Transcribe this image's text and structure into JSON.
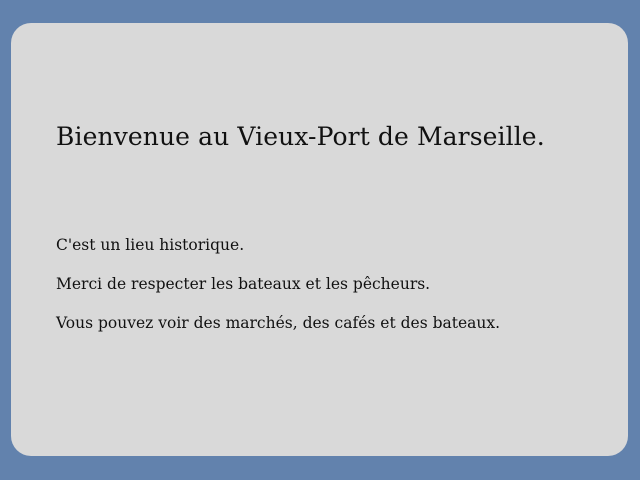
{
  "colors": {
    "background": "#6282ad",
    "card": "#d9d9d9",
    "text": "#111111"
  },
  "card": {
    "title": "Bienvenue au Vieux-Port de Marseille.",
    "lines": [
      "C'est un lieu historique.",
      "Merci de respecter les bateaux et les pêcheurs.",
      "Vous pouvez voir des marchés, des cafés et des bateaux."
    ]
  }
}
